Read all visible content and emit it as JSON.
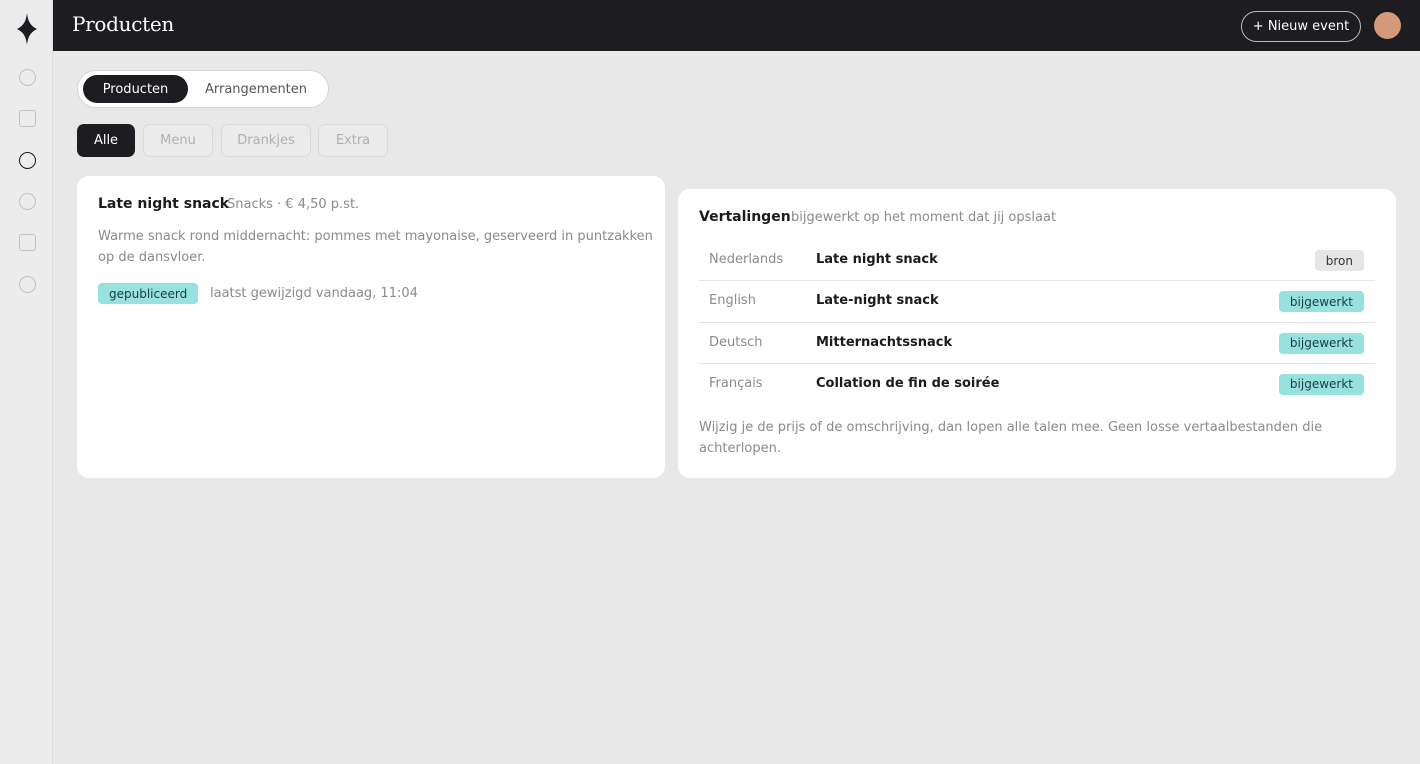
{
  "header": {
    "title": "Producten",
    "new_event_label": "+ Nieuw event"
  },
  "sidebar": {
    "items": [
      {
        "icon": "circle-icon",
        "active": false
      },
      {
        "icon": "square-icon",
        "active": false
      },
      {
        "icon": "circle-icon",
        "active": true
      },
      {
        "icon": "circle-icon",
        "active": false
      },
      {
        "icon": "square-icon",
        "active": false
      },
      {
        "icon": "circle-icon",
        "active": false
      }
    ]
  },
  "main_tabs": {
    "items": [
      "Producten",
      "Arrangementen"
    ],
    "selected": "Producten"
  },
  "filters": {
    "items": [
      "Alle",
      "Menu",
      "Drankjes",
      "Extra"
    ],
    "selected": "Alle"
  },
  "product": {
    "name": "Late night snack",
    "meta": "Snacks · € 4,50 p.st.",
    "description": "Warme snack rond middernacht: pommes met mayonaise, geserveerd in puntzakken op de dansvloer.",
    "status": "gepubliceerd",
    "last_edit": "laatst gewijzigd vandaag, 11:04"
  },
  "translations": {
    "title": "Vertalingen",
    "subtitle": "bijgewerkt op het moment dat jij opslaat",
    "rows": [
      {
        "language": "Nederlands",
        "value": "Late night snack",
        "badge": "bron"
      },
      {
        "language": "English",
        "value": "Late-night snack",
        "badge": "bijgewerkt"
      },
      {
        "language": "Deutsch",
        "value": "Mitternachtssnack",
        "badge": "bijgewerkt"
      },
      {
        "language": "Français",
        "value": "Collation de fin de soirée",
        "badge": "bijgewerkt"
      }
    ],
    "note": "Wijzig je de prijs of de omschrijving, dan lopen alle talen mee. Geen losse vertaalbestanden die achterlopen."
  },
  "colors": {
    "header_bg": "#1c1c21",
    "accent_teal": "#97e1de",
    "avatar": "#d49a77",
    "page_bg": "#e8e8e8"
  }
}
